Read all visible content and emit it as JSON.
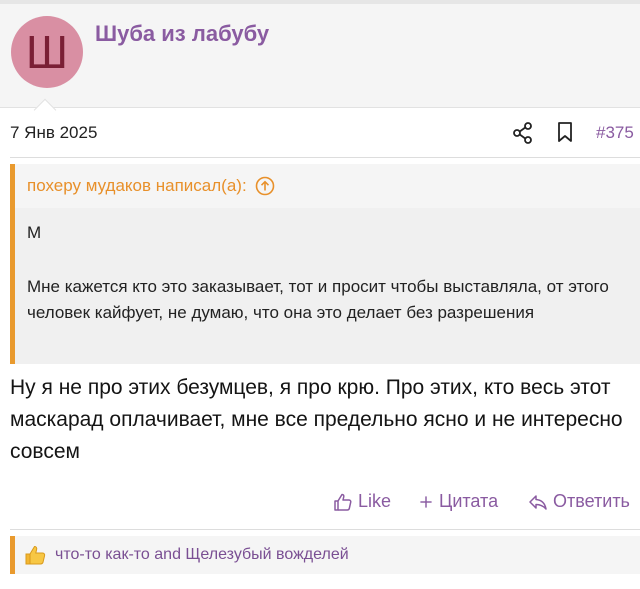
{
  "post": {
    "username": "Шуба из лабубу",
    "avatar_letter": "Ш",
    "date": "7 Янв 2025",
    "number": "#375",
    "quote": {
      "author": "похеру мудаков написал(а):",
      "line1": "М",
      "line2": "Мне кажется кто это заказывает, тот и просит чтобы выставляла, от этого человек кайфует, не думаю, что она это делает без разрешения"
    },
    "message": "Ну я не про этих безумцев, я про крю. Про этих, кто весь этот маскарад оплачивает, мне все предельно ясно и не интересно совсем",
    "actions": {
      "like": "Like",
      "quote": "Цитата",
      "reply": "Ответить"
    },
    "likes_text": "что-то как-то and Щелезубый вожделей"
  },
  "colors": {
    "accent": "#8a5ba1",
    "quote_border": "#e99a2e",
    "quote_author": "#e8902a",
    "avatar_bg": "#d98fa3"
  },
  "icons": [
    "share-icon",
    "bookmark-icon",
    "arrow-up-circle-icon",
    "thumbs-up-icon",
    "plus-icon",
    "reply-icon",
    "thumbs-up-emoji-icon"
  ]
}
